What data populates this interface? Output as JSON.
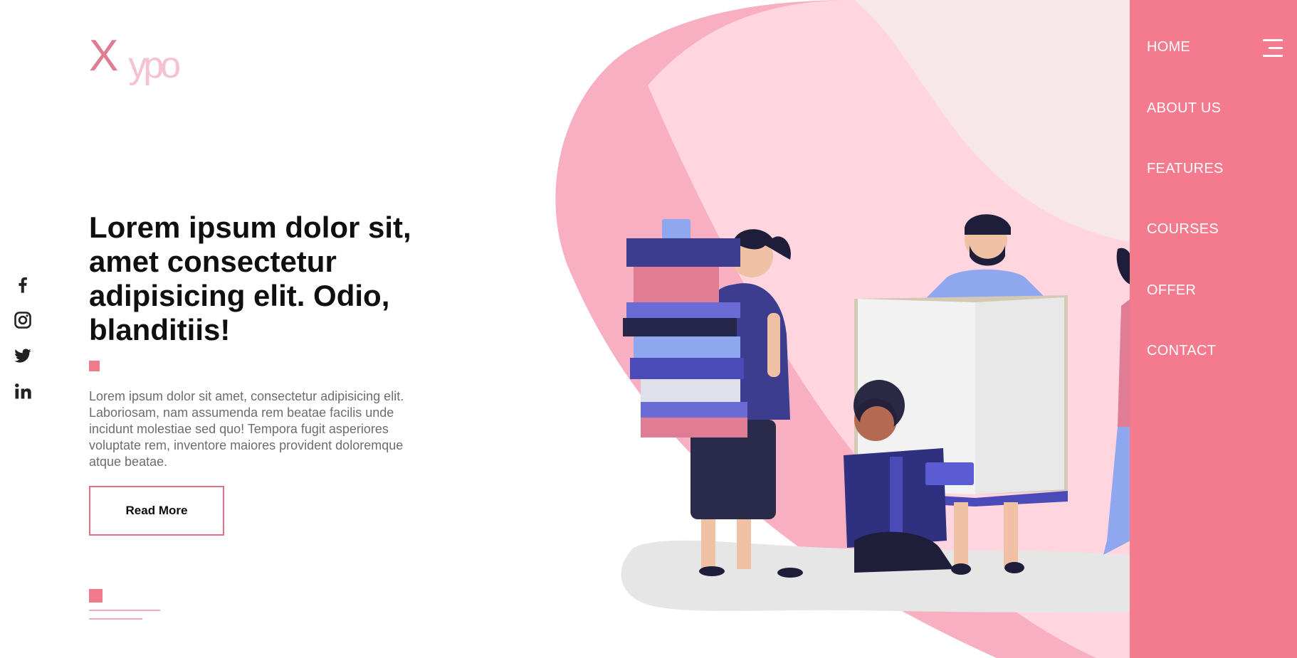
{
  "brand": {
    "logo_x": "X",
    "logo_rest": "ypo"
  },
  "social": [
    {
      "name": "facebook-icon"
    },
    {
      "name": "instagram-icon"
    },
    {
      "name": "twitter-icon"
    },
    {
      "name": "linkedin-icon"
    }
  ],
  "hero": {
    "title": "Lorem ipsum dolor sit, amet consectetur adipisicing elit. Odio, blanditiis!",
    "text": "Lorem ipsum dolor sit amet, consectetur adipisicing elit. Laboriosam, nam assumenda rem beatae facilis unde incidunt molestiae sed quo! Tempora fugit asperiores voluptate rem, inventore maiores provident doloremque atque beatae.",
    "button_label": "Read More"
  },
  "nav": {
    "items": [
      {
        "label": "HOME"
      },
      {
        "label": "ABOUT US"
      },
      {
        "label": "FEATURES"
      },
      {
        "label": "COURSES"
      },
      {
        "label": "OFFER"
      },
      {
        "label": "CONTACT"
      }
    ],
    "toggle_icon": "hamburger-menu-icon"
  },
  "colors": {
    "accent": "#f47a8d",
    "accent_border": "#ea6f86",
    "light_pink": "#ffd6df",
    "book_blue": "#3a3a8c"
  }
}
